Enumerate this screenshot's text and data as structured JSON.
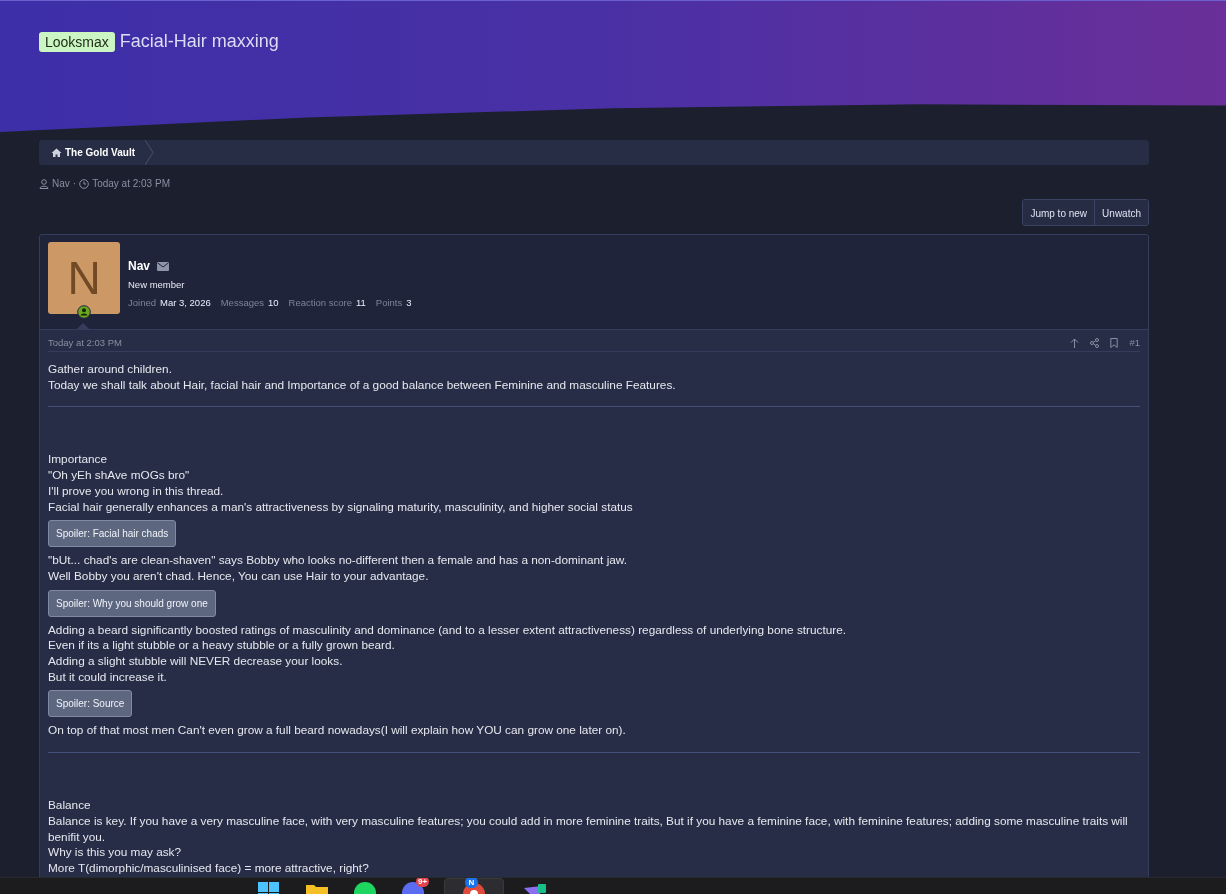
{
  "header": {
    "prefix": "Looksmax",
    "title": "Facial-Hair maxxing"
  },
  "breadcrumb": [
    {
      "label": "The Gold Vault"
    }
  ],
  "thread_meta": {
    "author": "Nav",
    "separator": "·",
    "time": "Today at 2:03 PM"
  },
  "actions": [
    "Jump to new",
    "Unwatch"
  ],
  "post": {
    "author": {
      "initial": "N",
      "name": "Nav",
      "title": "New member",
      "online": true,
      "stats": [
        {
          "label": "Joined",
          "value": "Mar 3, 2026"
        },
        {
          "label": "Messages",
          "value": "10"
        },
        {
          "label": "Reaction score",
          "value": "11"
        },
        {
          "label": "Points",
          "value": "3"
        }
      ]
    },
    "time": "Today at 2:03 PM",
    "number": "#1",
    "body": [
      {
        "kind": "text",
        "text": "Gather around children."
      },
      {
        "kind": "text",
        "text": "Today we shall talk about Hair, facial hair and Importance of a good balance between Feminine and masculine Features."
      },
      {
        "kind": "divider"
      },
      {
        "kind": "text",
        "text": "Importance"
      },
      {
        "kind": "text",
        "text": "\"Oh yEh shAve mOGs bro\""
      },
      {
        "kind": "text",
        "text": "I'll prove you wrong in this thread."
      },
      {
        "kind": "text",
        "text": "Facial hair generally enhances a man's attractiveness by signaling maturity, masculinity, and higher social status"
      },
      {
        "kind": "spoiler",
        "text": "Spoiler: Facial hair chads"
      },
      {
        "kind": "text",
        "text": "\"bUt... chad's are clean-shaven\" says Bobby who looks no-different then a female and has a non-dominant jaw."
      },
      {
        "kind": "text",
        "text": "Well Bobby you aren't chad. Hence, You can use Hair to your advantage."
      },
      {
        "kind": "spoiler",
        "text": "Spoiler: Why you should grow one"
      },
      {
        "kind": "text",
        "text": "Adding a beard significantly boosted ratings of masculinity and dominance (and to a lesser extent attractiveness) regardless of underlying bone structure."
      },
      {
        "kind": "text",
        "text": "Even if its a light stubble or a heavy stubble or a fully grown beard."
      },
      {
        "kind": "text",
        "text": "Adding a slight stubble will NEVER decrease your looks."
      },
      {
        "kind": "text",
        "text": "But it could increase it."
      },
      {
        "kind": "spoiler",
        "text": "Spoiler: Source"
      },
      {
        "kind": "text",
        "text": "On top of that most men Can't even grow a full beard nowadays(I will explain how YOU can grow one later on)."
      },
      {
        "kind": "divider"
      },
      {
        "kind": "text",
        "text": "Balance"
      },
      {
        "kind": "text",
        "text": "Balance is key. If you have a very masculine face, with very masculine features; you could add in more feminine traits, But if you have a feminine face, with feminine features; adding some masculine traits will benifit you."
      },
      {
        "kind": "text",
        "text": "Why is this you may ask?"
      },
      {
        "kind": "text",
        "text": "More T(dimorphic/masculinised face) = more attractive, right?"
      }
    ]
  },
  "taskbar": {
    "apps": [
      {
        "kind": "windows",
        "selected": false
      },
      {
        "kind": "folder",
        "selected": false
      },
      {
        "kind": "spotify",
        "selected": false
      },
      {
        "kind": "messenger",
        "badge": "9+",
        "selected": false
      },
      {
        "kind": "chrome",
        "badge": "N",
        "selected": true
      },
      {
        "kind": "vpn",
        "selected": false
      }
    ]
  }
}
